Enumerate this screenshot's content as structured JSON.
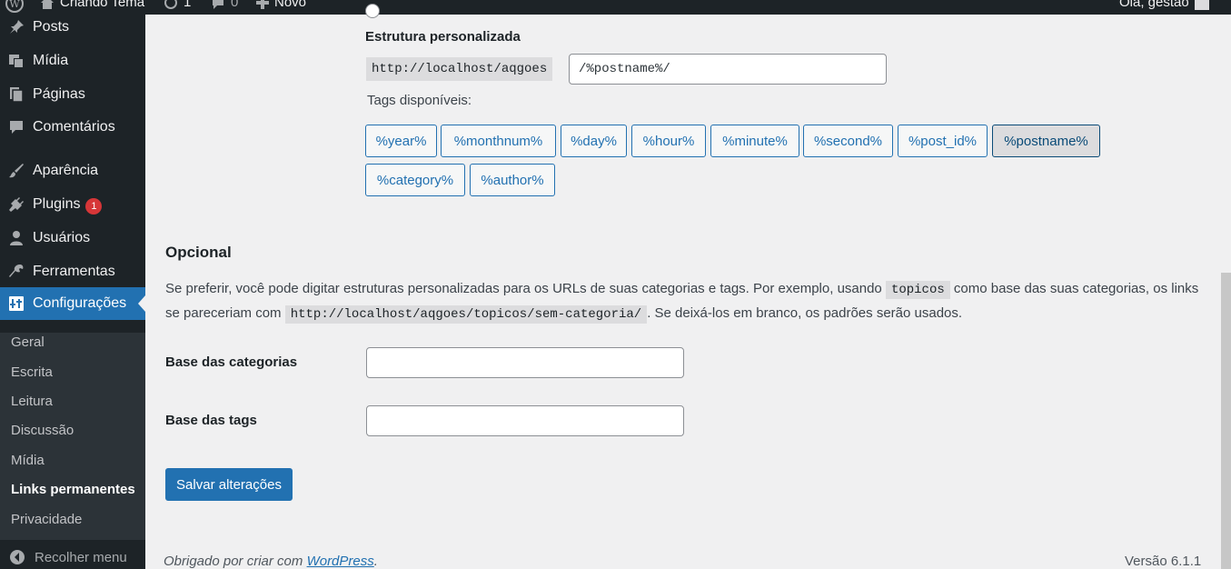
{
  "adminbar": {
    "site_name": "Criando Tema",
    "updates_count": "1",
    "comments_count": "0",
    "new_label": "Novo",
    "greeting": "Olá, gestao"
  },
  "sidebar": {
    "items": [
      {
        "label": "Posts",
        "icon": "pin-icon"
      },
      {
        "label": "Mídia",
        "icon": "media-icon"
      },
      {
        "label": "Páginas",
        "icon": "pages-icon"
      },
      {
        "label": "Comentários",
        "icon": "comments-icon"
      },
      {
        "label": "Aparência",
        "icon": "brush-icon"
      },
      {
        "label": "Plugins",
        "icon": "plugin-icon",
        "badge": "1"
      },
      {
        "label": "Usuários",
        "icon": "user-icon"
      },
      {
        "label": "Ferramentas",
        "icon": "wrench-icon"
      },
      {
        "label": "Configurações",
        "icon": "settings-icon"
      }
    ],
    "submenu": [
      "Geral",
      "Escrita",
      "Leitura",
      "Discussão",
      "Mídia",
      "Links permanentes",
      "Privacidade"
    ],
    "collapse_label": "Recolher menu"
  },
  "structure": {
    "custom_label": "Estrutura personalizada",
    "prefix": "http://localhost/aqgoes",
    "value": "/%postname%/",
    "tags_label": "Tags disponíveis:",
    "tags": [
      "%year%",
      "%monthnum%",
      "%day%",
      "%hour%",
      "%minute%",
      "%second%",
      "%post_id%",
      "%postname%",
      "%category%",
      "%author%"
    ]
  },
  "optional": {
    "title": "Opcional",
    "desc_part1": "Se preferir, você pode digitar estruturas personalizadas para os URLs de suas categorias e tags. Por exemplo, usando ",
    "desc_code1": "topicos",
    "desc_part2": " como base das suas categorias, os links se pareceriam com ",
    "desc_code2": "http://localhost/aqgoes/topicos/sem-categoria/",
    "desc_part3": ". Se deixá-los em branco, os padrões serão usados.",
    "category_base_label": "Base das categorias",
    "category_base_value": "",
    "tag_base_label": "Base das tags",
    "tag_base_value": ""
  },
  "save_label": "Salvar alterações",
  "footer": {
    "thanks_text": "Obrigado por criar com ",
    "wp_link": "WordPress",
    "period": ".",
    "version": "Versão 6.1.1"
  },
  "colors": {
    "primary": "#2271b1",
    "sidebar_bg": "#1d2327",
    "badge": "#d63638"
  }
}
